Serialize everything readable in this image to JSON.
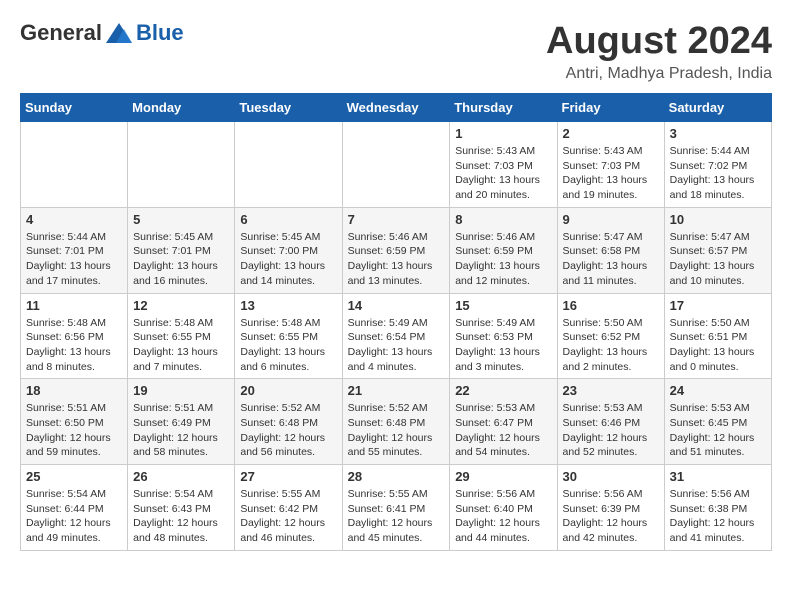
{
  "logo": {
    "general": "General",
    "blue": "Blue"
  },
  "title": "August 2024",
  "location": "Antri, Madhya Pradesh, India",
  "days_header": [
    "Sunday",
    "Monday",
    "Tuesday",
    "Wednesday",
    "Thursday",
    "Friday",
    "Saturday"
  ],
  "weeks": [
    [
      {
        "day": "",
        "info": ""
      },
      {
        "day": "",
        "info": ""
      },
      {
        "day": "",
        "info": ""
      },
      {
        "day": "",
        "info": ""
      },
      {
        "day": "1",
        "info": "Sunrise: 5:43 AM\nSunset: 7:03 PM\nDaylight: 13 hours\nand 20 minutes."
      },
      {
        "day": "2",
        "info": "Sunrise: 5:43 AM\nSunset: 7:03 PM\nDaylight: 13 hours\nand 19 minutes."
      },
      {
        "day": "3",
        "info": "Sunrise: 5:44 AM\nSunset: 7:02 PM\nDaylight: 13 hours\nand 18 minutes."
      }
    ],
    [
      {
        "day": "4",
        "info": "Sunrise: 5:44 AM\nSunset: 7:01 PM\nDaylight: 13 hours\nand 17 minutes."
      },
      {
        "day": "5",
        "info": "Sunrise: 5:45 AM\nSunset: 7:01 PM\nDaylight: 13 hours\nand 16 minutes."
      },
      {
        "day": "6",
        "info": "Sunrise: 5:45 AM\nSunset: 7:00 PM\nDaylight: 13 hours\nand 14 minutes."
      },
      {
        "day": "7",
        "info": "Sunrise: 5:46 AM\nSunset: 6:59 PM\nDaylight: 13 hours\nand 13 minutes."
      },
      {
        "day": "8",
        "info": "Sunrise: 5:46 AM\nSunset: 6:59 PM\nDaylight: 13 hours\nand 12 minutes."
      },
      {
        "day": "9",
        "info": "Sunrise: 5:47 AM\nSunset: 6:58 PM\nDaylight: 13 hours\nand 11 minutes."
      },
      {
        "day": "10",
        "info": "Sunrise: 5:47 AM\nSunset: 6:57 PM\nDaylight: 13 hours\nand 10 minutes."
      }
    ],
    [
      {
        "day": "11",
        "info": "Sunrise: 5:48 AM\nSunset: 6:56 PM\nDaylight: 13 hours\nand 8 minutes."
      },
      {
        "day": "12",
        "info": "Sunrise: 5:48 AM\nSunset: 6:55 PM\nDaylight: 13 hours\nand 7 minutes."
      },
      {
        "day": "13",
        "info": "Sunrise: 5:48 AM\nSunset: 6:55 PM\nDaylight: 13 hours\nand 6 minutes."
      },
      {
        "day": "14",
        "info": "Sunrise: 5:49 AM\nSunset: 6:54 PM\nDaylight: 13 hours\nand 4 minutes."
      },
      {
        "day": "15",
        "info": "Sunrise: 5:49 AM\nSunset: 6:53 PM\nDaylight: 13 hours\nand 3 minutes."
      },
      {
        "day": "16",
        "info": "Sunrise: 5:50 AM\nSunset: 6:52 PM\nDaylight: 13 hours\nand 2 minutes."
      },
      {
        "day": "17",
        "info": "Sunrise: 5:50 AM\nSunset: 6:51 PM\nDaylight: 13 hours\nand 0 minutes."
      }
    ],
    [
      {
        "day": "18",
        "info": "Sunrise: 5:51 AM\nSunset: 6:50 PM\nDaylight: 12 hours\nand 59 minutes."
      },
      {
        "day": "19",
        "info": "Sunrise: 5:51 AM\nSunset: 6:49 PM\nDaylight: 12 hours\nand 58 minutes."
      },
      {
        "day": "20",
        "info": "Sunrise: 5:52 AM\nSunset: 6:48 PM\nDaylight: 12 hours\nand 56 minutes."
      },
      {
        "day": "21",
        "info": "Sunrise: 5:52 AM\nSunset: 6:48 PM\nDaylight: 12 hours\nand 55 minutes."
      },
      {
        "day": "22",
        "info": "Sunrise: 5:53 AM\nSunset: 6:47 PM\nDaylight: 12 hours\nand 54 minutes."
      },
      {
        "day": "23",
        "info": "Sunrise: 5:53 AM\nSunset: 6:46 PM\nDaylight: 12 hours\nand 52 minutes."
      },
      {
        "day": "24",
        "info": "Sunrise: 5:53 AM\nSunset: 6:45 PM\nDaylight: 12 hours\nand 51 minutes."
      }
    ],
    [
      {
        "day": "25",
        "info": "Sunrise: 5:54 AM\nSunset: 6:44 PM\nDaylight: 12 hours\nand 49 minutes."
      },
      {
        "day": "26",
        "info": "Sunrise: 5:54 AM\nSunset: 6:43 PM\nDaylight: 12 hours\nand 48 minutes."
      },
      {
        "day": "27",
        "info": "Sunrise: 5:55 AM\nSunset: 6:42 PM\nDaylight: 12 hours\nand 46 minutes."
      },
      {
        "day": "28",
        "info": "Sunrise: 5:55 AM\nSunset: 6:41 PM\nDaylight: 12 hours\nand 45 minutes."
      },
      {
        "day": "29",
        "info": "Sunrise: 5:56 AM\nSunset: 6:40 PM\nDaylight: 12 hours\nand 44 minutes."
      },
      {
        "day": "30",
        "info": "Sunrise: 5:56 AM\nSunset: 6:39 PM\nDaylight: 12 hours\nand 42 minutes."
      },
      {
        "day": "31",
        "info": "Sunrise: 5:56 AM\nSunset: 6:38 PM\nDaylight: 12 hours\nand 41 minutes."
      }
    ]
  ]
}
